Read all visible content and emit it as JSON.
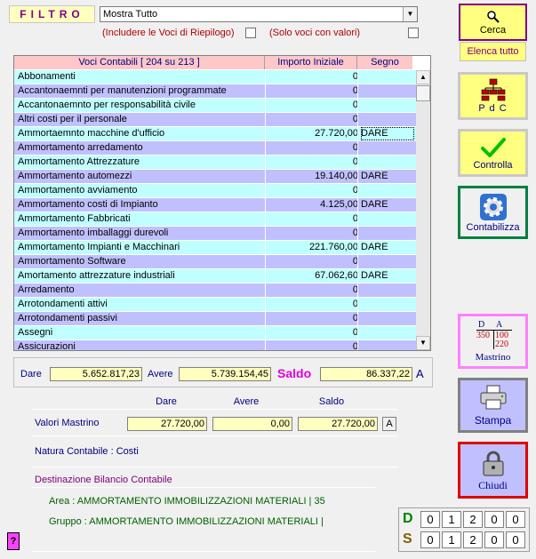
{
  "filter": {
    "label": "FILTRO",
    "selected": "Mostra Tutto",
    "include_summary_label": "(Includere le Voci di Riepilogo)",
    "only_values_label": "(Solo voci con valori)"
  },
  "table": {
    "headers": [
      "Voci Contabili [ 204 su 213 ]",
      "Importo Iniziale",
      "Segno"
    ],
    "rows": [
      {
        "name": "Abbonamenti",
        "amount": "0",
        "sign": ""
      },
      {
        "name": "Accantonaemnti per manutenzioni programmate",
        "amount": "0",
        "sign": ""
      },
      {
        "name": "Accantonaemnto per responsabilità civile",
        "amount": "0",
        "sign": ""
      },
      {
        "name": "Altri costi per il personale",
        "amount": "0",
        "sign": ""
      },
      {
        "name": "Ammortaemnto macchine d'ufficio",
        "amount": "27.720,00",
        "sign": "DARE"
      },
      {
        "name": "Ammortamento arredamento",
        "amount": "0",
        "sign": ""
      },
      {
        "name": "Ammortamento Attrezzature",
        "amount": "0",
        "sign": ""
      },
      {
        "name": "Ammortamento automezzi",
        "amount": "19.140,00",
        "sign": "DARE"
      },
      {
        "name": "Ammortamento avviamento",
        "amount": "0",
        "sign": ""
      },
      {
        "name": "Ammortamento costi di Impianto",
        "amount": "4.125,00",
        "sign": "DARE"
      },
      {
        "name": "Ammortamento Fabbricati",
        "amount": "0",
        "sign": ""
      },
      {
        "name": "Ammortamento imballaggi durevoli",
        "amount": "0",
        "sign": ""
      },
      {
        "name": "Ammortamento Impianti e Macchinari",
        "amount": "221.760,00",
        "sign": "DARE"
      },
      {
        "name": "Ammortamento Software",
        "amount": "0",
        "sign": ""
      },
      {
        "name": "Amortamento attrezzature industriali",
        "amount": "67.062,60",
        "sign": "DARE"
      },
      {
        "name": "Arredamento",
        "amount": "0",
        "sign": ""
      },
      {
        "name": "Arrotondamenti attivi",
        "amount": "0",
        "sign": ""
      },
      {
        "name": "Arrotondamenti passivi",
        "amount": "0",
        "sign": ""
      },
      {
        "name": "Assegni",
        "amount": "0",
        "sign": ""
      },
      {
        "name": "Assicurazioni",
        "amount": "0",
        "sign": ""
      }
    ]
  },
  "totals": {
    "dare_label": "Dare",
    "dare_value": "5.652.817,23",
    "avere_label": "Avere",
    "avere_value": "5.739.154,45",
    "saldo_label": "Saldo",
    "saldo_value": "86.337,22",
    "saldo_sign": "A"
  },
  "mastrino": {
    "col_dare": "Dare",
    "col_avere": "Avere",
    "col_saldo": "Saldo",
    "label": "Valori Mastrino",
    "dare": "27.720,00",
    "avere": "0,00",
    "saldo": "27.720,00",
    "sign": "A",
    "natura": "Natura Contabile : Costi",
    "destinazione": "Destinazione Bilancio Contabile",
    "area": "Area : AMMORTAMENTO IMMOBILIZZAZIONI MATERIALI | 35",
    "gruppo": "Gruppo : AMMORTAMENTO IMMOBILIZZAZIONI MATERIALI |"
  },
  "buttons": {
    "cerca": "Cerca",
    "elenca": "Elenca tutto",
    "pdc": "P d C",
    "controlla": "Controlla",
    "contabilizza": "Contabilizza",
    "mastrino": "Mastrino",
    "mastrino_d": "D",
    "mastrino_a": "A",
    "mastrino_n1": "350",
    "mastrino_n2": "100",
    "mastrino_n3": "220",
    "stampa": "Stampa",
    "chiudi": "Chiudi",
    "help": "?"
  },
  "counters": {
    "d_label": "D",
    "d_digits": [
      "0",
      "1",
      "2",
      "0",
      "0"
    ],
    "s_label": "S",
    "s_digits": [
      "0",
      "1",
      "2",
      "0",
      "0"
    ]
  },
  "colors": {
    "accent_purple": "#800080",
    "highlight_yellow": "#ffffc0",
    "row_cyan": "#c0ffff",
    "row_lavender": "#c0c0ff"
  }
}
